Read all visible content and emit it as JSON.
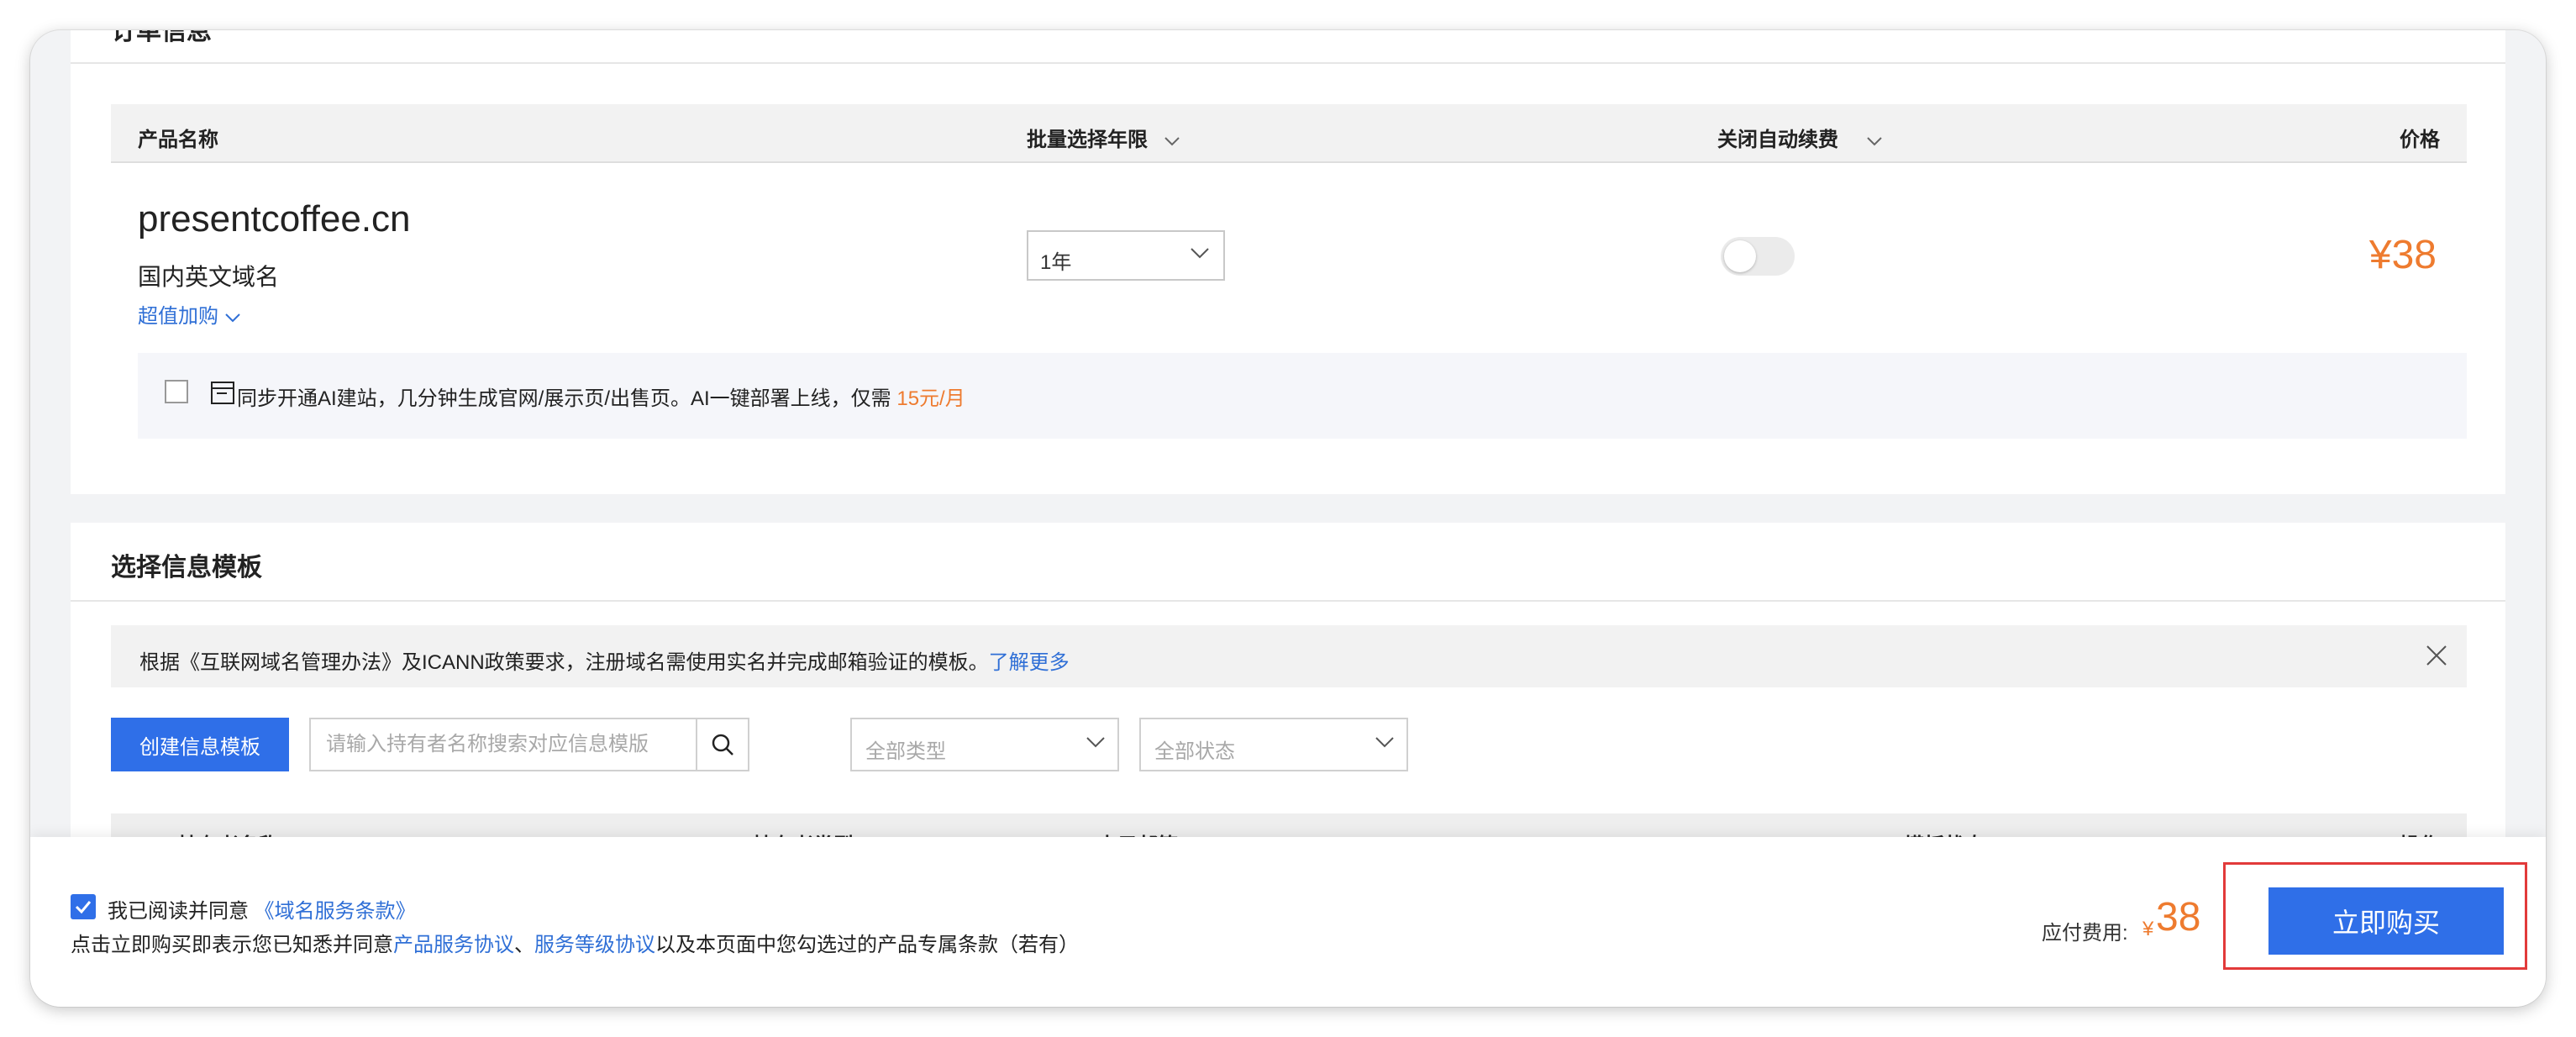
{
  "order_card": {
    "cut_title": "订单信息",
    "columns": {
      "product_name": "产品名称",
      "batch_years": "批量选择年限",
      "auto_renew": "关闭自动续费",
      "price": "价格"
    },
    "item": {
      "domain": "presentcoffee.cn",
      "type": "国内英文域名",
      "upsell_label": "超值加购",
      "year_value": "1年",
      "auto_renew_on": false,
      "price": "¥38"
    },
    "ai_banner": {
      "text": "同步开通AI建站，几分钟生成官网/展示页/出售页。AI一键部署上线，仅需",
      "price_text": "15元/月",
      "checked": false
    }
  },
  "template_card": {
    "title": "选择信息模板",
    "notice": {
      "text": "根据《互联网域名管理办法》及ICANN政策要求，注册域名需使用实名并完成邮箱验证的模板。",
      "link": "了解更多"
    },
    "create_button": "创建信息模板",
    "search_placeholder": "请输入持有者名称搜索对应信息模版",
    "type_filter": "全部类型",
    "status_filter": "全部状态",
    "columns": {
      "holder_name": "持有者名称",
      "holder_type": "持有者类型",
      "email": "电子邮箱",
      "template_status": "模板状态",
      "action": "操作"
    }
  },
  "footer": {
    "agree_checked": true,
    "agree_text": "我已阅读并同意",
    "agree_link": "《域名服务条款》",
    "notice_prefix": "点击立即购买即表示您已知悉并同意",
    "link_product_agreement": "产品服务协议",
    "separator": "、",
    "link_sla": "服务等级协议",
    "notice_suffix": "以及本页面中您勾选过的产品专属条款（若有）",
    "pay_label": "应付费用:",
    "pay_currency": "¥",
    "pay_amount": "38",
    "buy_button": "立即购买"
  },
  "colors": {
    "accent": "#2f6fe8",
    "price": "#ee7b2f",
    "highlight": "#e23a3a"
  }
}
